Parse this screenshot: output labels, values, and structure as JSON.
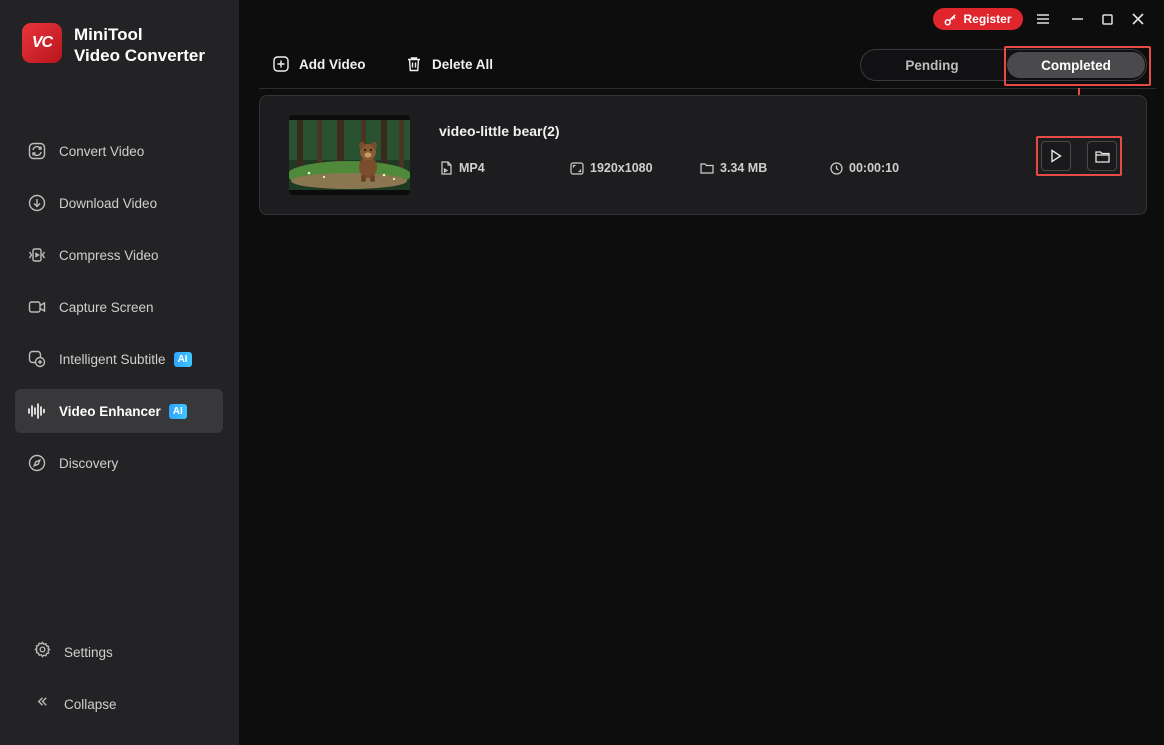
{
  "app": {
    "name_line1": "MiniTool",
    "name_line2": "Video Converter",
    "logo_text": "VC"
  },
  "sidebar": {
    "items": [
      {
        "label": "Convert Video",
        "icon": "convert-icon"
      },
      {
        "label": "Download Video",
        "icon": "download-icon"
      },
      {
        "label": "Compress Video",
        "icon": "compress-icon"
      },
      {
        "label": "Capture Screen",
        "icon": "camera-icon"
      },
      {
        "label": "Intelligent Subtitle",
        "icon": "subtitle-icon",
        "badge": "AI"
      },
      {
        "label": "Video Enhancer",
        "icon": "waveform-icon",
        "badge": "AI",
        "active": true
      },
      {
        "label": "Discovery",
        "icon": "compass-icon"
      }
    ],
    "settings_label": "Settings",
    "collapse_label": "Collapse"
  },
  "titlebar": {
    "register_label": "Register"
  },
  "toolbar": {
    "add_video_label": "Add Video",
    "delete_all_label": "Delete All"
  },
  "tabs": {
    "pending_label": "Pending",
    "completed_label": "Completed",
    "active": "Completed"
  },
  "file": {
    "title": "video-little bear(2)",
    "format": "MP4",
    "resolution": "1920x1080",
    "size": "3.34 MB",
    "duration": "00:00:10"
  },
  "colors": {
    "accent_red": "#e0262d",
    "highlight": "#e84a45",
    "ai_badge": "#2fa4ff",
    "sidebar_bg": "#232325"
  }
}
